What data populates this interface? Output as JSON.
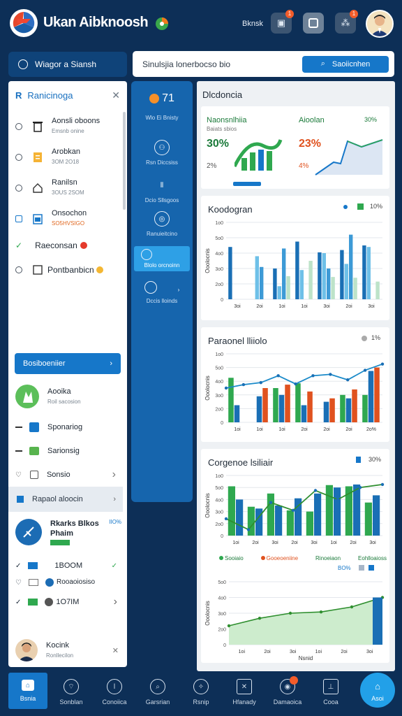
{
  "header": {
    "app_title": "Ukan Aibknoosh",
    "label": "Bknsk",
    "notifications_badge": "1",
    "apps_badge": "1"
  },
  "nav_pill": {
    "label": "Wiagor a Siansh"
  },
  "search": {
    "text": "Sinulsjia lonerbocso bio",
    "button_label": "Saoiicnhen"
  },
  "left_panel": {
    "title": "Ranicinoga",
    "items": [
      {
        "label": "Aonsli oboons",
        "sub": "Emsnb onine"
      },
      {
        "label": "Arobkan",
        "sub": "3OM 2O18"
      },
      {
        "label": "Ranilsn",
        "sub": "3OUS 2SOM"
      },
      {
        "label": "Onsochon",
        "sub": "SO5HVSIGO"
      },
      {
        "label": "Raeconsan",
        "sub": ""
      },
      {
        "label": "Pontbanbicn",
        "sub": ""
      }
    ],
    "blue_button": "Bosiboeniier",
    "profile": {
      "name": "Aooika",
      "sub": "Roil sacosion"
    },
    "menu": [
      "Sponariog",
      "Sarionsig",
      "Sonsio"
    ],
    "gray_row": "Rapaol aloocin",
    "profile2": {
      "name": "Rkarks Blkos",
      "name2": "Phaim",
      "stat": "IIO%"
    },
    "mini": [
      "1BOOM",
      "Rooaoiosiso",
      "1O7IM"
    ],
    "footer_profile": {
      "name": "Kocink",
      "sub": "Ronllecilon"
    }
  },
  "mid_nav": {
    "top_value": "71",
    "top_label": "Wlo Ei Bnisty",
    "items": [
      {
        "label": "Rsn Diccsiss"
      },
      {
        "label": "Dcio Sllsgoos"
      },
      {
        "label": "Ranuieitcino"
      },
      {
        "label": "Blolo orcnoinn"
      },
      {
        "label": "Dccis lloinds"
      }
    ]
  },
  "content": {
    "title": "Dlcdoncia",
    "stats": {
      "left_title": "Naonsnlhiia",
      "left_sub": "Baiats sbios",
      "left_value": "30%",
      "left_small": "2%",
      "right_title": "Aioolan",
      "right_pct": "30%",
      "right_value": "23%",
      "right_small": "4%"
    },
    "chart1_title": "Koodogran",
    "chart1_legend": "10%",
    "chart2_title": "Paraonel lliiolo",
    "chart2_legend": "1%",
    "chart3_title": "Corgenoe lsiliair",
    "chart3_legend": "30%",
    "legend3": [
      "Sooiaio",
      "Gooeoeniine",
      "Rinoeiaon",
      "Eohlloaioss"
    ],
    "legend3_pct": "BO%",
    "chart4_xlabel": "Nsnid",
    "ylabel": "Ooolocnis"
  },
  "chart_data": [
    {
      "type": "bar",
      "title": "Koodogran",
      "categories": [
        "3oi",
        "2oi",
        "1oi",
        "1oi",
        "3oi",
        "2oi",
        "3oi"
      ],
      "ylim": [
        0,
        100
      ],
      "yticks": [
        "0",
        "2o0",
        "3o0",
        "4o0",
        "5o0",
        "1o0"
      ],
      "series": [
        {
          "values": [
            68,
            0,
            40,
            75,
            61,
            64,
            70
          ]
        },
        {
          "values": [
            0,
            56,
            17,
            38,
            60,
            46,
            68
          ]
        },
        {
          "values": [
            0,
            42,
            66,
            0,
            40,
            84,
            0
          ]
        },
        {
          "values": [
            0,
            0,
            30,
            50,
            29,
            28,
            23
          ]
        }
      ]
    },
    {
      "type": "bar",
      "title": "Paraonel lliiolo",
      "categories": [
        "1oi",
        "1oi",
        "1oi",
        "2oi",
        "2oi",
        "2oi",
        "2o%"
      ],
      "ylim": [
        0,
        100
      ],
      "yticks": [
        "0",
        "2o0",
        "3o0",
        "4o0",
        "5o0",
        "1o0"
      ],
      "series": [
        {
          "values": [
            65,
            0,
            50,
            57,
            0,
            40,
            40
          ]
        },
        {
          "values": [
            25,
            38,
            40,
            25,
            30,
            35,
            75
          ]
        },
        {
          "values": [
            0,
            50,
            55,
            45,
            35,
            48,
            80
          ]
        }
      ],
      "line": [
        50,
        55,
        58,
        68,
        56,
        68,
        70,
        62,
        76,
        85
      ]
    },
    {
      "type": "bar",
      "title": "Corgenoe lsiliair",
      "categories": [
        "1oi",
        "2oi",
        "3oi",
        "2oi",
        "3oi",
        "1oi",
        "2oi",
        "3oi"
      ],
      "ylim": [
        0,
        100
      ],
      "yticks": [
        "0",
        "2o0",
        "3o0",
        "4o0",
        "5o0",
        "1o0"
      ],
      "series": [
        {
          "values": [
            82,
            48,
            70,
            42,
            40,
            84,
            82,
            55
          ]
        },
        {
          "values": [
            60,
            45,
            50,
            62,
            70,
            80,
            85,
            67
          ]
        }
      ],
      "line": [
        28,
        10,
        55,
        42,
        75,
        60,
        80,
        85
      ]
    },
    {
      "type": "area",
      "title": "",
      "xlabel": "Nsnid",
      "categories": [
        "1oi",
        "2oi",
        "3oi",
        "1oi",
        "2oi",
        "3oi"
      ],
      "ylim": [
        0,
        100
      ],
      "yticks": [
        "0",
        "2o0",
        "3o0",
        "4o0",
        "5o0"
      ],
      "values": [
        30,
        42,
        50,
        52,
        60,
        75
      ]
    }
  ],
  "bottom_nav": [
    "Bsnia",
    "Sonblan",
    "Conoiica",
    "Garsrian",
    "Rsnip",
    "Hfanady",
    "Damaoica",
    "Cooa",
    "Asoi"
  ]
}
